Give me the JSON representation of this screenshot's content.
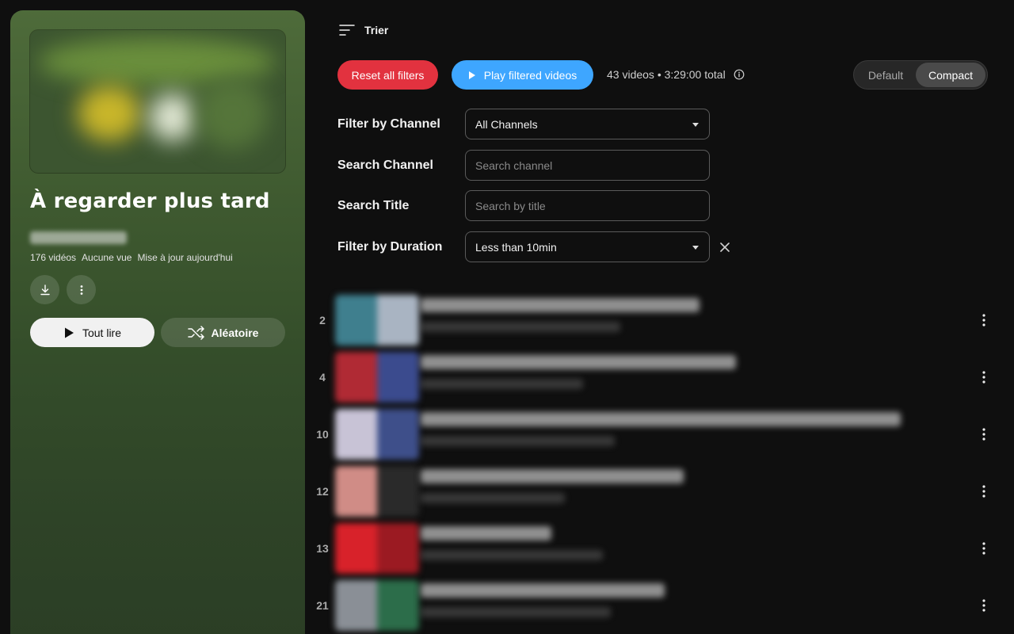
{
  "playlist": {
    "title": "À regarder plus tard",
    "stats": {
      "count": "176 vidéos",
      "views": "Aucune vue",
      "updated": "Mise à jour aujourd'hui"
    },
    "play_all_label": "Tout lire",
    "shuffle_label": "Aléatoire",
    "icons": [
      "download-icon",
      "more-vert-icon",
      "play-icon",
      "shuffle-icon"
    ]
  },
  "toolbar": {
    "sort_label": "Trier",
    "reset_label": "Reset all filters",
    "play_filtered_label": "Play filtered videos",
    "summary": "43 videos • 3:29:00 total",
    "view_default": "Default",
    "view_compact": "Compact",
    "active_view": "Compact"
  },
  "filters": {
    "channel": {
      "label": "Filter by Channel",
      "value": "All Channels"
    },
    "search_channel": {
      "label": "Search Channel",
      "placeholder": "Search channel"
    },
    "search_title": {
      "label": "Search Title",
      "placeholder": "Search by title"
    },
    "duration": {
      "label": "Filter by Duration",
      "value": "Less than 10min"
    }
  },
  "videos": [
    {
      "index": "2"
    },
    {
      "index": "4"
    },
    {
      "index": "10"
    },
    {
      "index": "12"
    },
    {
      "index": "13"
    },
    {
      "index": "21"
    }
  ],
  "colors": {
    "reset": "#e2323f",
    "play_filtered": "#3ea6ff",
    "panel_green": "#3f5a30",
    "background": "#0f0f0f"
  }
}
